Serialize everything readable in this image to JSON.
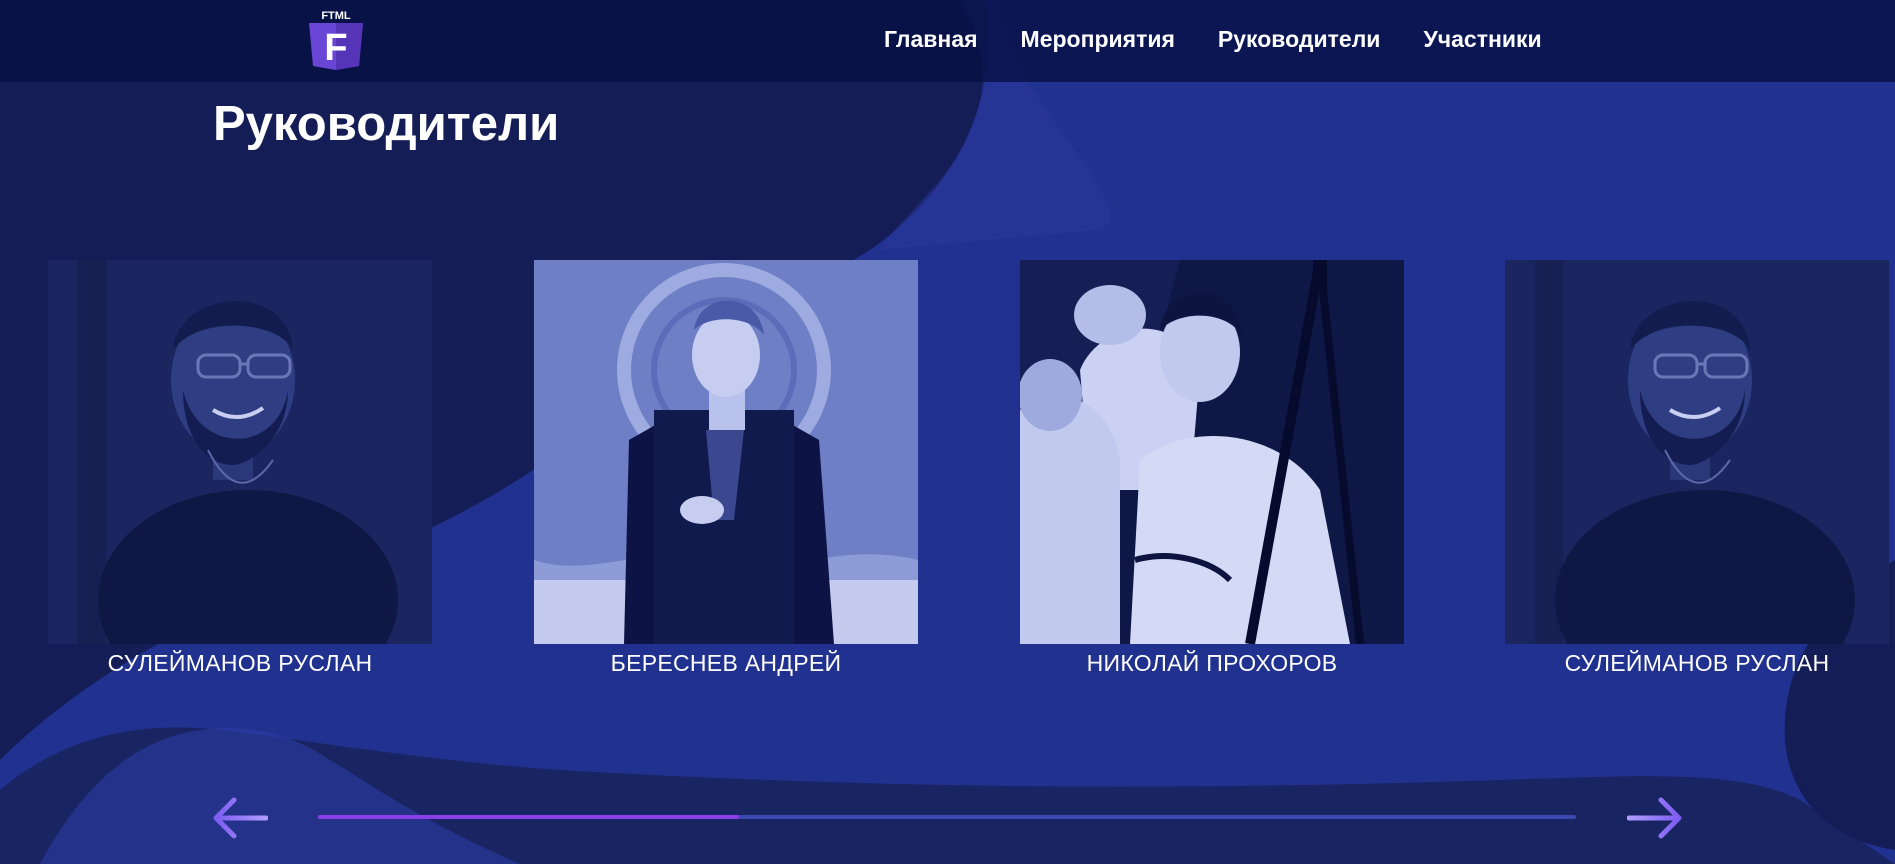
{
  "logo": {
    "text": "FTML",
    "letter": "F"
  },
  "nav": {
    "items": [
      {
        "label": "Главная"
      },
      {
        "label": "Мероприятия"
      },
      {
        "label": "Руководители"
      },
      {
        "label": "Участники"
      }
    ]
  },
  "page": {
    "title": "Руководители"
  },
  "carousel": {
    "cards": [
      {
        "name": "СУЛЕЙМАНОВ РУСЛАН"
      },
      {
        "name": "БЕРЕСНЕВ АНДРЕЙ"
      },
      {
        "name": "НИКОЛАЙ ПРОХОРОВ"
      },
      {
        "name": "СУЛЕЙМАНОВ РУСЛАН"
      }
    ],
    "progress": 0.335
  },
  "colors": {
    "background": "#21318f",
    "dark_blob": "#141d55",
    "header": "#061042",
    "accent_purple": "#8b3ee8",
    "arrow": "#9a7cf0"
  },
  "icons": {
    "prev": "arrow-left-icon",
    "next": "arrow-right-icon"
  }
}
